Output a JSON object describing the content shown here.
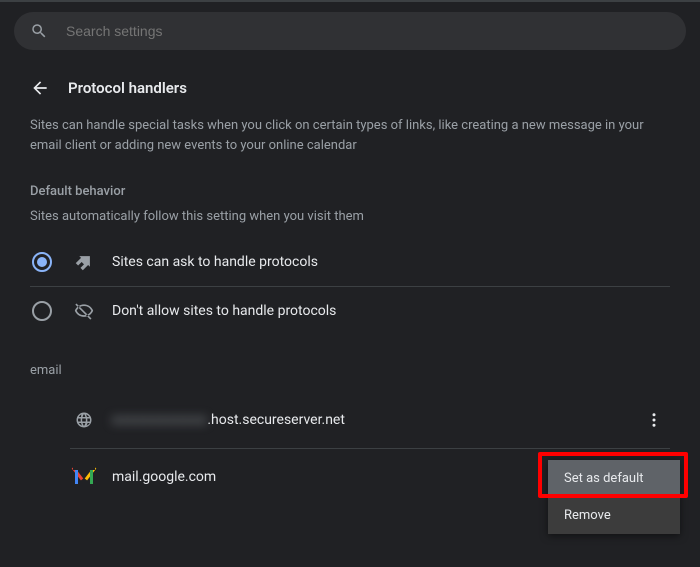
{
  "search": {
    "placeholder": "Search settings"
  },
  "header": {
    "title": "Protocol handlers"
  },
  "description": "Sites can handle special tasks when you click on certain types of links, like creating a new message in your email client or adding new events to your online calendar",
  "default_behavior": {
    "heading": "Default behavior",
    "subtext": "Sites automatically follow this setting when you visit them",
    "options": [
      {
        "label": "Sites can ask to handle protocols",
        "selected": true
      },
      {
        "label": "Don't allow sites to handle protocols",
        "selected": false
      }
    ]
  },
  "protocol_section": {
    "heading": "email",
    "sites": [
      {
        "hidden_prefix": "xxxxxxxxxxxx",
        "visible": ".host.secureserver.net"
      },
      {
        "visible": "mail.google.com"
      }
    ]
  },
  "menu": {
    "set_default": "Set as default",
    "remove": "Remove"
  }
}
